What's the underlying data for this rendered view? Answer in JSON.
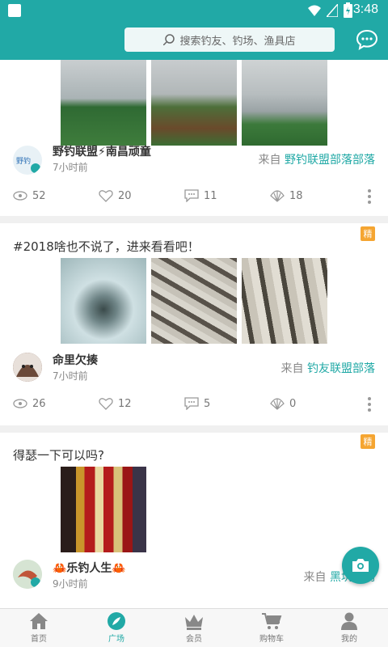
{
  "status": {
    "time": "3:48"
  },
  "header": {
    "search_placeholder": "搜索钓友、钓场、渔具店"
  },
  "posts": [
    {
      "user": "野钓联盟⚡南昌顽童",
      "time": "7小时前",
      "from_label": "来自",
      "tribe": "野钓联盟部落部落",
      "stats": {
        "views": "52",
        "likes": "20",
        "comments": "11",
        "shares": "18"
      }
    },
    {
      "title": "#2018啥也不说了，进来看看吧！",
      "badge": "精",
      "user": "命里欠揍",
      "time": "7小时前",
      "from_label": "来自",
      "tribe": "钓友联盟部落",
      "stats": {
        "views": "26",
        "likes": "12",
        "comments": "5",
        "shares": "0"
      }
    },
    {
      "title": "得瑟一下可以吗?",
      "badge": "精",
      "user": "🦀乐钓人生🦀",
      "time": "9小时前",
      "from_label": "来自",
      "tribe": "黑坑休闲"
    }
  ],
  "tabs": [
    {
      "label": "首页",
      "icon": "home-icon"
    },
    {
      "label": "广场",
      "icon": "plaza-icon"
    },
    {
      "label": "会员",
      "icon": "crown-icon"
    },
    {
      "label": "购物车",
      "icon": "cart-icon"
    },
    {
      "label": "我的",
      "icon": "person-icon"
    }
  ],
  "colors": {
    "accent": "#21a9a6",
    "badge": "#f5a531"
  }
}
